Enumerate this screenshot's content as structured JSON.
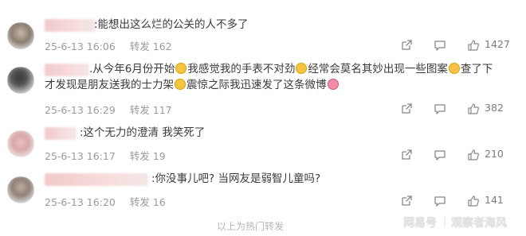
{
  "comments": [
    {
      "text": ":能想出这么烂的公关的人不多了",
      "time": "25-6-13 16:06",
      "repost": "转发 162",
      "likes": "1427"
    },
    {
      "text_line1a": ".从今年6月份开始",
      "text_line1b": "我感觉我的手表不对劲",
      "text_line1c": "经常会莫名其妙出现一些图案",
      "text_line1d": "查了下",
      "text_line2a": "才发现是朋友送我的士力架",
      "text_line2b": "震惊之际我迅速发了这条微博",
      "time": "25-6-13 16:29",
      "repost": "转发 117",
      "likes": "382"
    },
    {
      "text": ":这个无力的澄清 我笑死了",
      "time": "25-6-13 16:17",
      "repost": "转发 19",
      "likes": "210"
    },
    {
      "text": ":你没事儿吧? 当网友是弱智儿童吗?",
      "time": "25-6-13 16:20",
      "repost": "转发 16",
      "likes": "141"
    }
  ],
  "footer_text": "以上为热门转发",
  "watermark_brand": "网易号",
  "watermark_sep": "|",
  "watermark_name": "观察者海风",
  "icons": {
    "share": "share-icon",
    "comment": "comment-icon",
    "like": "like-icon"
  }
}
